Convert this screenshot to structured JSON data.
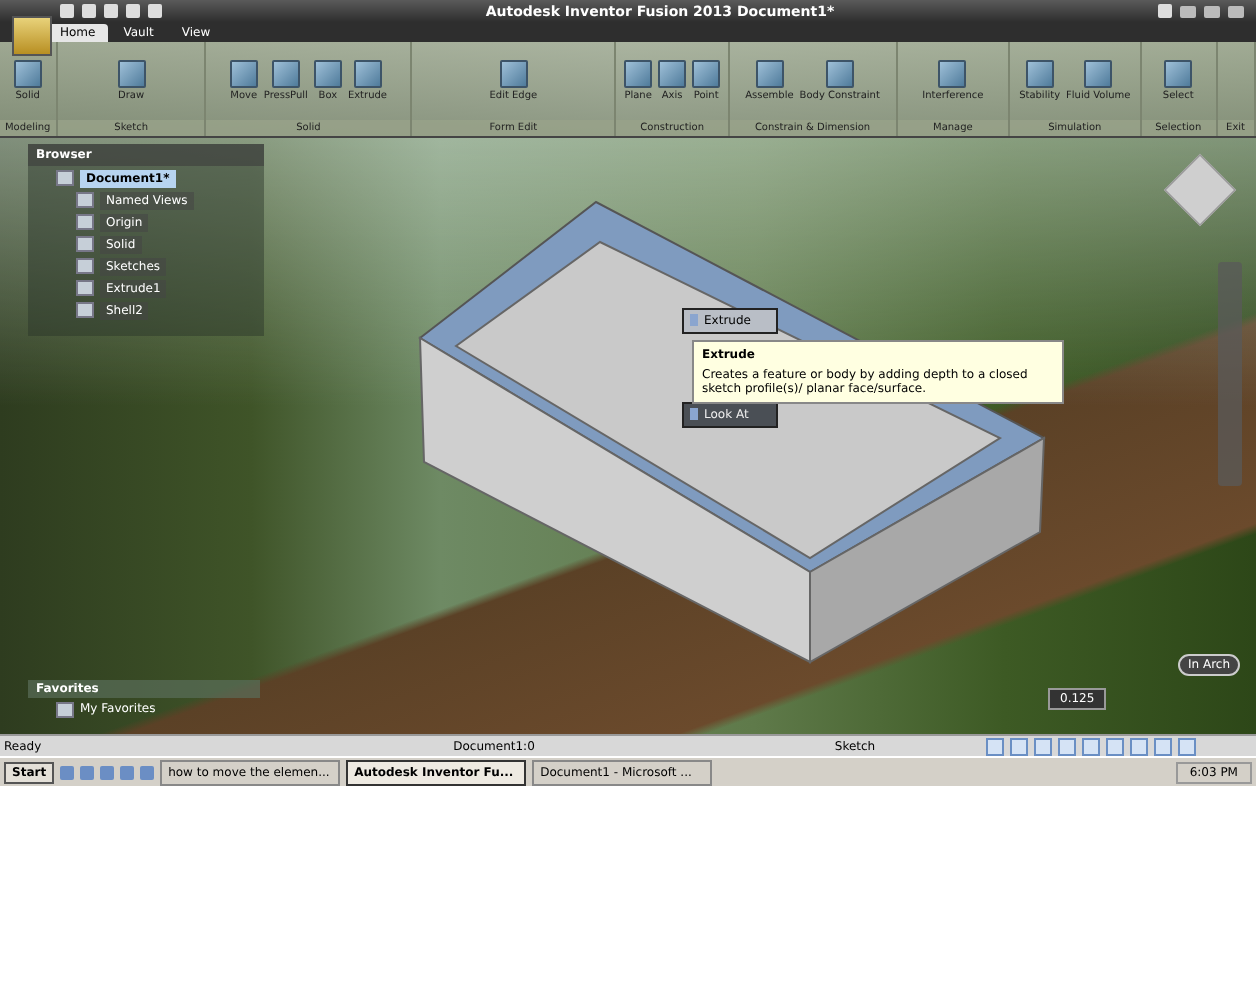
{
  "window": {
    "title": "Autodesk Inventor Fusion 2013   Document1*"
  },
  "tabs": [
    {
      "label": "Home",
      "selected": true
    },
    {
      "label": "Vault",
      "selected": false
    },
    {
      "label": "View",
      "selected": false
    }
  ],
  "ribbon": {
    "groups": [
      {
        "label": "Modeling",
        "tools": [
          "Solid"
        ]
      },
      {
        "label": "Sketch",
        "tools": [
          "Draw"
        ]
      },
      {
        "label": "Solid",
        "tools": [
          "Move",
          "PressPull",
          "Box",
          "Extrude"
        ]
      },
      {
        "label": "Form Edit",
        "tools": [
          "Edit Edge"
        ]
      },
      {
        "label": "Construction",
        "tools": [
          "Plane",
          "Axis",
          "Point"
        ]
      },
      {
        "label": "Constrain & Dimension",
        "tools": [
          "Assemble",
          "Body Constraint"
        ]
      },
      {
        "label": "Manage",
        "tools": [
          "Interference"
        ]
      },
      {
        "label": "Simulation",
        "tools": [
          "Stability",
          "Fluid Volume"
        ]
      },
      {
        "label": "Selection",
        "tools": [
          "Select"
        ]
      },
      {
        "label": "Exit"
      }
    ]
  },
  "browser": {
    "title": "Browser",
    "tree": [
      {
        "label": "Document1*",
        "selected": true,
        "children": [
          {
            "label": "Named Views",
            "selected": false
          },
          {
            "label": "Origin",
            "selected": false
          },
          {
            "label": "Solid",
            "selected": false
          },
          {
            "label": "Sketches",
            "selected": false
          },
          {
            "label": "Extrude1",
            "selected": false
          },
          {
            "label": "Shell2",
            "selected": false
          }
        ]
      }
    ]
  },
  "favorites": {
    "title": "Favorites",
    "items": [
      "My Favorites"
    ]
  },
  "context_menu": {
    "items": [
      {
        "label": "Extrude",
        "selected": true
      },
      {
        "label": "Look At",
        "selected": false
      }
    ]
  },
  "tooltip": {
    "title": "Extrude",
    "text": "Creates a feature or body by adding depth to a closed sketch profile(s)/ planar face/surface."
  },
  "badge": "In Arch",
  "dimension": "0.125",
  "status_bar": {
    "message": "Ready",
    "document": "Document1:0",
    "mode": "Sketch"
  },
  "taskbar": {
    "start": "Start",
    "tasks": [
      {
        "label": "how to move the elemen...",
        "selected": false
      },
      {
        "label": "Autodesk Inventor Fu...",
        "selected": true
      },
      {
        "label": "Document1 - Microsoft ...",
        "selected": false
      }
    ],
    "clock": "6:03 PM"
  }
}
